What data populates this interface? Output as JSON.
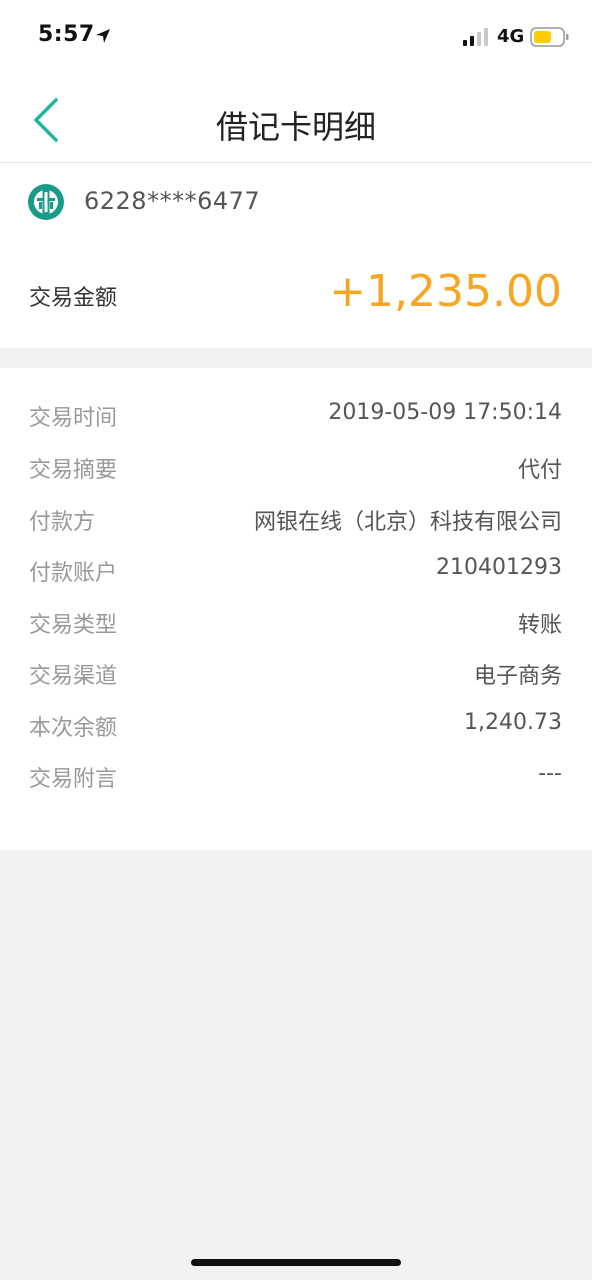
{
  "status_bar": {
    "time": "5:57",
    "network": "4G",
    "battery_color": "#ffcc00"
  },
  "nav": {
    "title": "借记卡明细"
  },
  "card": {
    "number": "6228****6477",
    "amount_label": "交易金额",
    "amount_value": "+1,235.00",
    "amount_color": "#f5a623",
    "logo_color": "#1a9b8a"
  },
  "details": [
    {
      "label": "交易时间",
      "value": "2019-05-09 17:50:14"
    },
    {
      "label": "交易摘要",
      "value": "代付"
    },
    {
      "label": "付款方",
      "value": "网银在线（北京）科技有限公司"
    },
    {
      "label": "付款账户",
      "value": "210401293"
    },
    {
      "label": "交易类型",
      "value": "转账"
    },
    {
      "label": "交易渠道",
      "value": "电子商务"
    },
    {
      "label": "本次余额",
      "value": "1,240.73"
    },
    {
      "label": "交易附言",
      "value": "---"
    }
  ]
}
